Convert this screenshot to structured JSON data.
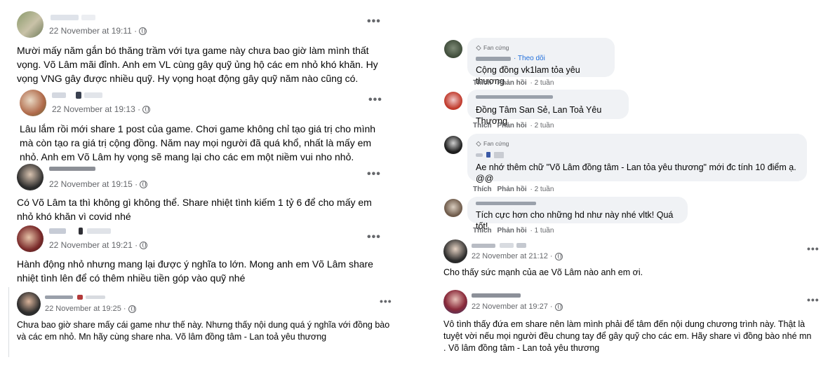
{
  "colors": {
    "text": "#050505",
    "meta": "#65676b",
    "link": "#216fdb",
    "bubble": "#f0f2f5"
  },
  "left_posts": [
    {
      "timestamp": "22 November at 19:11 ·",
      "text": "Mười mấy năm gắn bó thăng trầm với tựa game này chưa bao giờ làm mình thất vọng. Võ Lâm mãi đỉnh. Anh em VL cùng gây quỹ ủng hộ các em nhỏ khó khăn. Hy vọng VNG gây được nhiều quỹ. Hy vọng hoạt động gây quỹ năm nào cũng có."
    },
    {
      "timestamp": "22 November at 19:13 ·",
      "text": "Lâu lắm rồi mới share 1 post của game. Chơi game không chỉ tạo giá trị cho mình mà còn tạo ra giá trị cộng đồng. Năm nay mọi người đã quá khổ, nhất là mấy em nhỏ. Anh em Võ Lâm hy vọng sẽ mang lại cho các em một niềm vui nho nhỏ."
    },
    {
      "timestamp": "22 November at 19:15 ·",
      "text": "Có Võ Lâm ta thì không gì không thể. Share nhiệt tình kiếm 1 tỷ 6 để cho mấy em nhỏ khó khăn vì covid nhé"
    },
    {
      "timestamp": "22 November at 19:21 ·",
      "text": "Hành động nhỏ nhưng mang lại được ý nghĩa to lớn. Mong anh em Võ Lâm share nhiệt tình lên để có thêm nhiều tiền góp vào quỹ nhé"
    },
    {
      "timestamp": "22 November at 19:25 ·",
      "text": "Chưa bao giờ share mấy cái game như thế này. Nhưng thấy nội dung quá ý nghĩa với đồng bào và các em nhỏ. Mn hãy cùng share nha. Võ lâm đồng tâm - Lan toả yêu thương"
    }
  ],
  "comments": [
    {
      "badge": "Fan cứng",
      "follow": "· Theo dõi",
      "text": "Cộng đồng vk1lam tỏa yêu thương",
      "like": "Thích",
      "reply": "Phản hồi",
      "time": "· 2 tuần"
    },
    {
      "text": "Đồng Tâm San Sẻ, Lan Toả Yêu Thương",
      "like": "Thích",
      "reply": "Phản hồi",
      "time": "· 2 tuần"
    },
    {
      "badge": "Fan cứng",
      "text": "Ae nhớ thêm chữ \"Võ Lâm đồng tâm - Lan tỏa yêu thương\" mới đc tính 10 điểm ạ. @@",
      "like": "Thích",
      "reply": "Phản hồi",
      "time": "· 2 tuần"
    },
    {
      "text": "Tích cực hơn cho những hd như này nhé vltk! Quá tốt!",
      "like": "Thích",
      "reply": "Phản hồi",
      "time": "· 1 tuần"
    }
  ],
  "right_posts": [
    {
      "timestamp": "22 November at 21:12 ·",
      "text": "Cho thấy sức mạnh của ae Võ Lâm nào anh em ơi."
    },
    {
      "timestamp": "22 November at 19:27 ·",
      "text": "Vô tình thấy đứa em share nên làm mình phải để tâm đến nội dung chương trình này. Thật là tuyệt vời nếu mọi người đều chung tay để gây quỹ cho các em. Hãy share vì đồng bào nhé mn . Võ lâm đồng tâm - Lan toả yêu thương"
    }
  ],
  "more_label": "•••"
}
